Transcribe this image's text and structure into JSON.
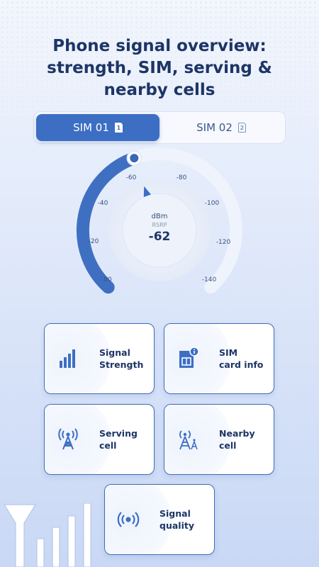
{
  "title": "Phone signal overview: strength, SIM, serving & nearby cells",
  "sim_tabs": [
    {
      "label": "SIM 01",
      "badge": "1",
      "active": true
    },
    {
      "label": "SIM 02",
      "badge": "2",
      "active": false
    }
  ],
  "gauge": {
    "unit": "dBm",
    "metric": "RSRP",
    "value": "-62",
    "ticks": [
      "00",
      "-20",
      "-40",
      "-60",
      "-80",
      "-100",
      "-120",
      "-140"
    ],
    "fill_fraction": 0.43
  },
  "cards": [
    {
      "label": "Signal\nStrength",
      "icon": "signal-bars-icon"
    },
    {
      "label": "SIM\ncard info",
      "icon": "sim-card-icon"
    },
    {
      "label": "Serving\ncell",
      "icon": "cell-tower-icon"
    },
    {
      "label": "Nearby\ncell",
      "icon": "nearby-tower-icon"
    },
    {
      "label": "Signal\nquality",
      "icon": "broadcast-icon"
    }
  ],
  "colors": {
    "accent": "#3c6ec4",
    "dark_text": "#1d3566",
    "track": "#eef3fc"
  }
}
